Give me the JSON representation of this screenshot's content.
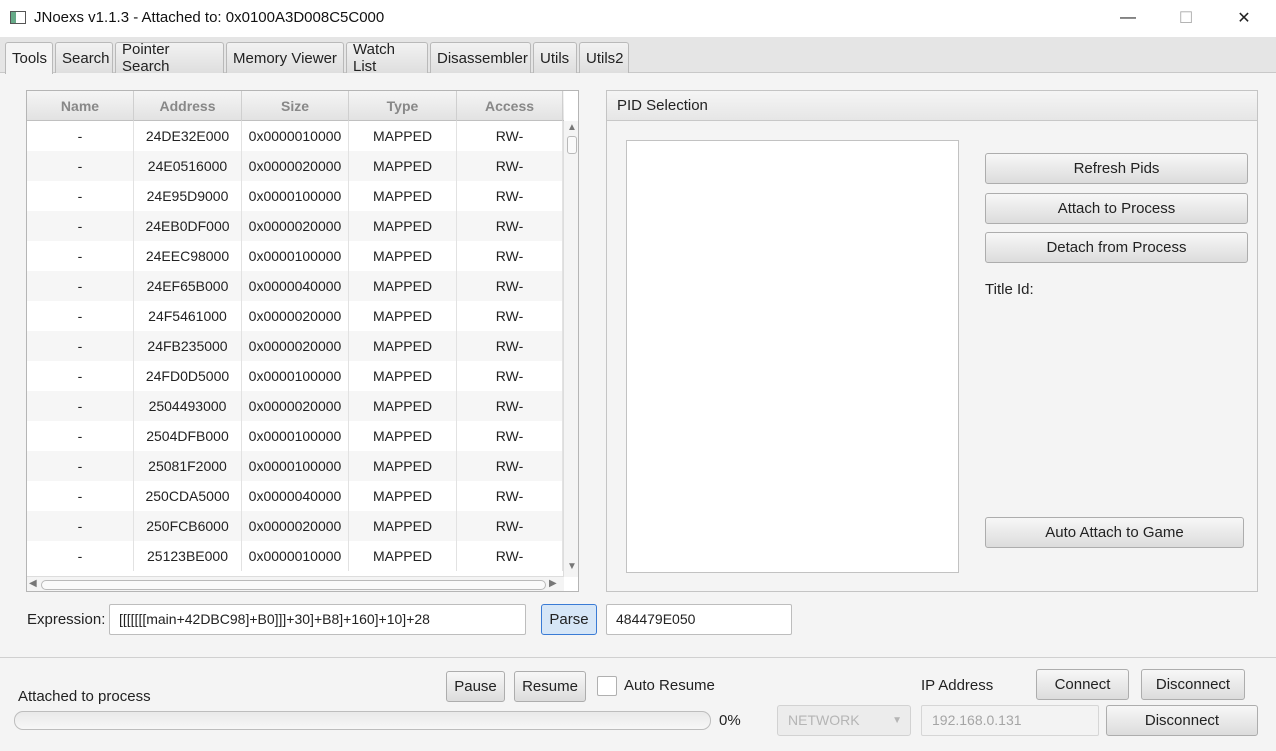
{
  "window": {
    "title": "JNoexs v1.1.3 - Attached to: 0x0100A3D008C5C000",
    "minimize": "—",
    "maximize": "☐",
    "close": "✕"
  },
  "tabs": [
    "Tools",
    "Search",
    "Pointer Search",
    "Memory Viewer",
    "Watch List",
    "Disassembler",
    "Utils",
    "Utils2"
  ],
  "memory_table": {
    "columns": [
      "Name",
      "Address",
      "Size",
      "Type",
      "Access"
    ],
    "rows": [
      [
        "-",
        "24DE32E000",
        "0x0000010000",
        "MAPPED",
        "RW-"
      ],
      [
        "-",
        "24E0516000",
        "0x0000020000",
        "MAPPED",
        "RW-"
      ],
      [
        "-",
        "24E95D9000",
        "0x0000100000",
        "MAPPED",
        "RW-"
      ],
      [
        "-",
        "24EB0DF000",
        "0x0000020000",
        "MAPPED",
        "RW-"
      ],
      [
        "-",
        "24EEC98000",
        "0x0000100000",
        "MAPPED",
        "RW-"
      ],
      [
        "-",
        "24EF65B000",
        "0x0000040000",
        "MAPPED",
        "RW-"
      ],
      [
        "-",
        "24F5461000",
        "0x0000020000",
        "MAPPED",
        "RW-"
      ],
      [
        "-",
        "24FB235000",
        "0x0000020000",
        "MAPPED",
        "RW-"
      ],
      [
        "-",
        "24FD0D5000",
        "0x0000100000",
        "MAPPED",
        "RW-"
      ],
      [
        "-",
        "2504493000",
        "0x0000020000",
        "MAPPED",
        "RW-"
      ],
      [
        "-",
        "2504DFB000",
        "0x0000100000",
        "MAPPED",
        "RW-"
      ],
      [
        "-",
        "25081F2000",
        "0x0000100000",
        "MAPPED",
        "RW-"
      ],
      [
        "-",
        "250CDA5000",
        "0x0000040000",
        "MAPPED",
        "RW-"
      ],
      [
        "-",
        "250FCB6000",
        "0x0000020000",
        "MAPPED",
        "RW-"
      ],
      [
        "-",
        "25123BE000",
        "0x0000010000",
        "MAPPED",
        "RW-"
      ]
    ]
  },
  "pid_selection": {
    "header": "PID Selection",
    "refresh_label": "Refresh Pids",
    "attach_label": "Attach to Process",
    "detach_label": "Detach from Process",
    "title_id_label": "Title Id:",
    "auto_attach_label": "Auto Attach to Game"
  },
  "expression": {
    "label": "Expression:",
    "value": "[[[[[[[main+42DBC98]+B0]]]+30]+B8]+160]+10]+28",
    "parse_label": "Parse",
    "result": "484479E050"
  },
  "status": {
    "text": "Attached to process",
    "progress_percent_label": "0%",
    "progress": 0,
    "pause_label": "Pause",
    "resume_label": "Resume",
    "auto_resume_label": "Auto Resume",
    "auto_resume_checked": false
  },
  "connection": {
    "mode_value": "NETWORK",
    "ip_label": "IP Address",
    "ip_value": "192.168.0.131",
    "connect_label": "Connect",
    "disconnect_label": "Disconnect",
    "disconnect2_label": "Disconnect"
  },
  "colors": {
    "accent_border": "#3a7bd5",
    "parse_bg": "#d6e6f7"
  }
}
